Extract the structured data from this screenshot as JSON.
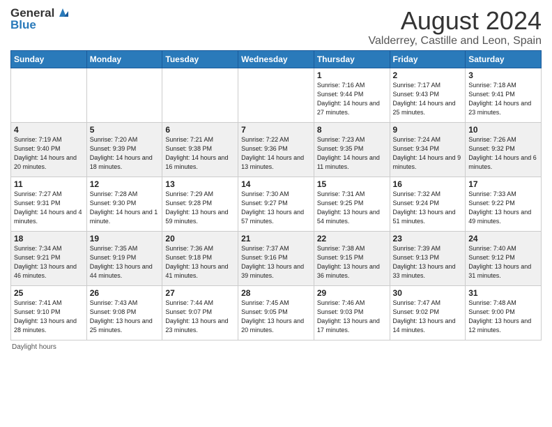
{
  "header": {
    "logo_text_general": "General",
    "logo_text_blue": "Blue",
    "main_title": "August 2024",
    "subtitle": "Valderrey, Castille and Leon, Spain"
  },
  "columns": [
    "Sunday",
    "Monday",
    "Tuesday",
    "Wednesday",
    "Thursday",
    "Friday",
    "Saturday"
  ],
  "weeks": [
    [
      {
        "day": "",
        "info": ""
      },
      {
        "day": "",
        "info": ""
      },
      {
        "day": "",
        "info": ""
      },
      {
        "day": "",
        "info": ""
      },
      {
        "day": "1",
        "info": "Sunrise: 7:16 AM\nSunset: 9:44 PM\nDaylight: 14 hours and 27 minutes."
      },
      {
        "day": "2",
        "info": "Sunrise: 7:17 AM\nSunset: 9:43 PM\nDaylight: 14 hours and 25 minutes."
      },
      {
        "day": "3",
        "info": "Sunrise: 7:18 AM\nSunset: 9:41 PM\nDaylight: 14 hours and 23 minutes."
      }
    ],
    [
      {
        "day": "4",
        "info": "Sunrise: 7:19 AM\nSunset: 9:40 PM\nDaylight: 14 hours and 20 minutes."
      },
      {
        "day": "5",
        "info": "Sunrise: 7:20 AM\nSunset: 9:39 PM\nDaylight: 14 hours and 18 minutes."
      },
      {
        "day": "6",
        "info": "Sunrise: 7:21 AM\nSunset: 9:38 PM\nDaylight: 14 hours and 16 minutes."
      },
      {
        "day": "7",
        "info": "Sunrise: 7:22 AM\nSunset: 9:36 PM\nDaylight: 14 hours and 13 minutes."
      },
      {
        "day": "8",
        "info": "Sunrise: 7:23 AM\nSunset: 9:35 PM\nDaylight: 14 hours and 11 minutes."
      },
      {
        "day": "9",
        "info": "Sunrise: 7:24 AM\nSunset: 9:34 PM\nDaylight: 14 hours and 9 minutes."
      },
      {
        "day": "10",
        "info": "Sunrise: 7:26 AM\nSunset: 9:32 PM\nDaylight: 14 hours and 6 minutes."
      }
    ],
    [
      {
        "day": "11",
        "info": "Sunrise: 7:27 AM\nSunset: 9:31 PM\nDaylight: 14 hours and 4 minutes."
      },
      {
        "day": "12",
        "info": "Sunrise: 7:28 AM\nSunset: 9:30 PM\nDaylight: 14 hours and 1 minute."
      },
      {
        "day": "13",
        "info": "Sunrise: 7:29 AM\nSunset: 9:28 PM\nDaylight: 13 hours and 59 minutes."
      },
      {
        "day": "14",
        "info": "Sunrise: 7:30 AM\nSunset: 9:27 PM\nDaylight: 13 hours and 57 minutes."
      },
      {
        "day": "15",
        "info": "Sunrise: 7:31 AM\nSunset: 9:25 PM\nDaylight: 13 hours and 54 minutes."
      },
      {
        "day": "16",
        "info": "Sunrise: 7:32 AM\nSunset: 9:24 PM\nDaylight: 13 hours and 51 minutes."
      },
      {
        "day": "17",
        "info": "Sunrise: 7:33 AM\nSunset: 9:22 PM\nDaylight: 13 hours and 49 minutes."
      }
    ],
    [
      {
        "day": "18",
        "info": "Sunrise: 7:34 AM\nSunset: 9:21 PM\nDaylight: 13 hours and 46 minutes."
      },
      {
        "day": "19",
        "info": "Sunrise: 7:35 AM\nSunset: 9:19 PM\nDaylight: 13 hours and 44 minutes."
      },
      {
        "day": "20",
        "info": "Sunrise: 7:36 AM\nSunset: 9:18 PM\nDaylight: 13 hours and 41 minutes."
      },
      {
        "day": "21",
        "info": "Sunrise: 7:37 AM\nSunset: 9:16 PM\nDaylight: 13 hours and 39 minutes."
      },
      {
        "day": "22",
        "info": "Sunrise: 7:38 AM\nSunset: 9:15 PM\nDaylight: 13 hours and 36 minutes."
      },
      {
        "day": "23",
        "info": "Sunrise: 7:39 AM\nSunset: 9:13 PM\nDaylight: 13 hours and 33 minutes."
      },
      {
        "day": "24",
        "info": "Sunrise: 7:40 AM\nSunset: 9:12 PM\nDaylight: 13 hours and 31 minutes."
      }
    ],
    [
      {
        "day": "25",
        "info": "Sunrise: 7:41 AM\nSunset: 9:10 PM\nDaylight: 13 hours and 28 minutes."
      },
      {
        "day": "26",
        "info": "Sunrise: 7:43 AM\nSunset: 9:08 PM\nDaylight: 13 hours and 25 minutes."
      },
      {
        "day": "27",
        "info": "Sunrise: 7:44 AM\nSunset: 9:07 PM\nDaylight: 13 hours and 23 minutes."
      },
      {
        "day": "28",
        "info": "Sunrise: 7:45 AM\nSunset: 9:05 PM\nDaylight: 13 hours and 20 minutes."
      },
      {
        "day": "29",
        "info": "Sunrise: 7:46 AM\nSunset: 9:03 PM\nDaylight: 13 hours and 17 minutes."
      },
      {
        "day": "30",
        "info": "Sunrise: 7:47 AM\nSunset: 9:02 PM\nDaylight: 13 hours and 14 minutes."
      },
      {
        "day": "31",
        "info": "Sunrise: 7:48 AM\nSunset: 9:00 PM\nDaylight: 13 hours and 12 minutes."
      }
    ]
  ],
  "footer": {
    "daylight_label": "Daylight hours"
  }
}
